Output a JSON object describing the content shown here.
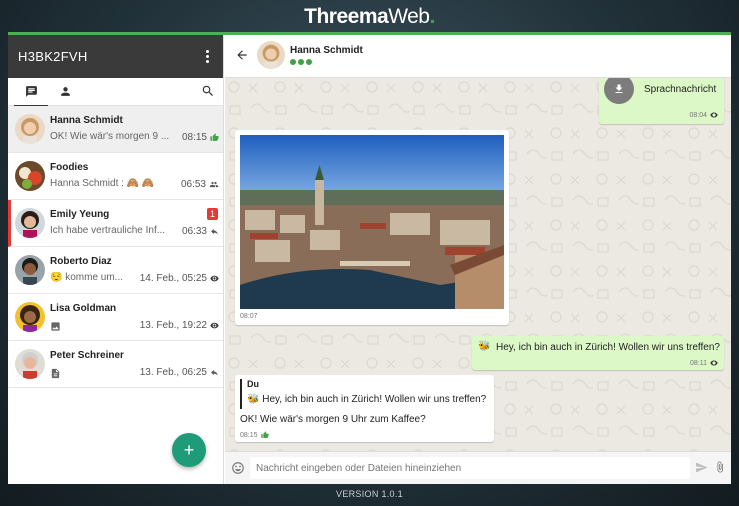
{
  "brand": {
    "part1": "Threema",
    "part2": "Web",
    "dot": "."
  },
  "version": "VERSION 1.0.1",
  "sidebar": {
    "identity": "H3BK2FVH",
    "conversations": [
      {
        "name": "Hanna Schmidt",
        "preview": "OK! Wie wär's morgen 9 ...",
        "time": "08:15",
        "status": "thumbs-up-icon"
      },
      {
        "name": "Foodies",
        "preview": "Hanna Schmidt : 🙈 🙈",
        "time": "06:53",
        "status": "group-icon"
      },
      {
        "name": "Emily Yeung",
        "preview": "Ich habe vertrauliche Inf...",
        "time": "06:33",
        "status": "reply-icon",
        "badge": "1"
      },
      {
        "name": "Roberto Diaz",
        "preview": "😌 komme um...",
        "time": "14. Feb., 05:25",
        "status": "eye-icon"
      },
      {
        "name": "Lisa Goldman",
        "preview": "",
        "time": "13. Feb., 19:22",
        "status": "eye-icon"
      },
      {
        "name": "Peter Schreiner",
        "preview": "",
        "time": "13. Feb., 06:25",
        "status": "reply-icon"
      }
    ],
    "fab": "+"
  },
  "chat": {
    "contact": "Hanna Schmidt",
    "messages": [
      {
        "type": "voice",
        "label": "Sprachnachricht",
        "time": "08:04"
      },
      {
        "type": "image",
        "time": "08:07"
      },
      {
        "type": "text",
        "text": "Hey, ich bin auch in Zürich! Wollen wir uns treffen?",
        "time": "08:11"
      },
      {
        "type": "quote",
        "quote_author": "Du",
        "quote_text": "Hey, ich bin auch in Zürich! Wollen wir uns treffen?",
        "text": "OK! Wie wär's morgen 9 Uhr zum Kaffee?",
        "time": "08:15"
      }
    ],
    "composer_placeholder": "Nachricht eingeben oder Dateien hineinziehen"
  },
  "colors": {
    "accent": "#4caf50",
    "header": "#3a3a3a",
    "fab": "#1e9c7a",
    "badge": "#e53935",
    "outgoing": "#dcf8c6"
  }
}
